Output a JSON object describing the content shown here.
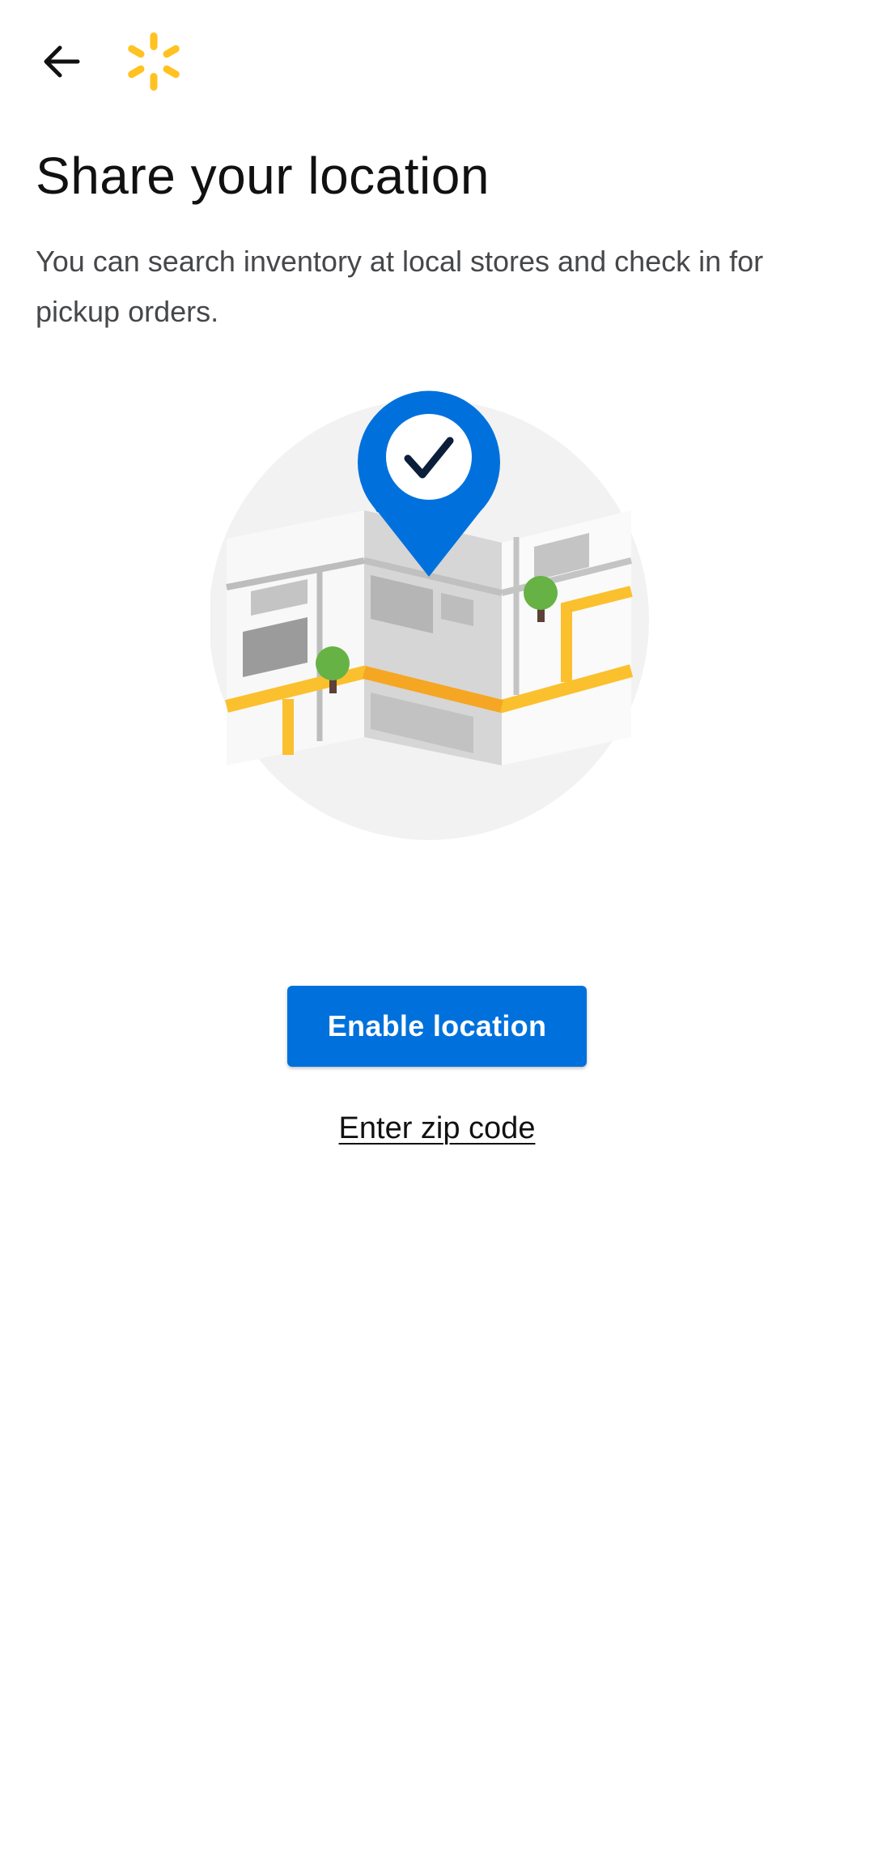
{
  "header": {
    "back_icon": "arrow-left-icon",
    "logo_icon": "walmart-spark-icon",
    "logo_color": "#ffc220"
  },
  "main": {
    "title": "Share your location",
    "description": "You can search inventory at local stores and check in for pickup orders.",
    "illustration_icon": "map-location-pin-check-icon",
    "enable_button_label": "Enable location",
    "zip_link_label": "Enter zip code"
  },
  "colors": {
    "primary_blue": "#0071dc",
    "spark_yellow": "#ffc220",
    "road_yellow": "#fbc02d",
    "tree_green": "#66b245"
  }
}
